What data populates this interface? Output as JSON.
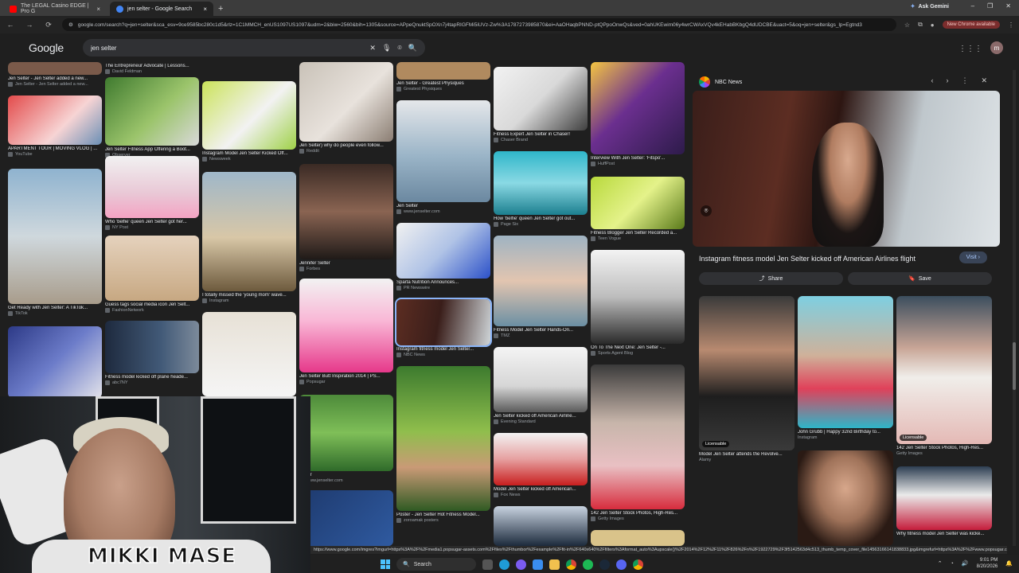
{
  "browser": {
    "tabs": [
      {
        "title": "The LEGAL Casino EDGE | Pro G",
        "color": "#ff0000"
      },
      {
        "title": "jen selter - Google Search",
        "color": "#4285f4"
      }
    ],
    "ask_gemini": "Ask Gemini",
    "url": "google.com/search?q=jen+selter&sca_esv=9ce9585bc280c1d5&rlz=1C1MMCH_enUS1097US1097&udm=2&biw=2560&bih=1305&source=APpeQnuktSpOXn7j4tapRIGFMi5iUVz-Zw%3A1787273985870&ei=AaOHaqbPNND-ptQPpoOnwQs&ved=0ahUKEwim06y4wrCWAxVQv4kEHabBKbgQ4dUDCBE&uact=5&oq=jen+selter&gs_lp=Egtnd3",
    "new_chrome": "New Chrome available"
  },
  "google": {
    "logo": "Google",
    "query": "jen selter"
  },
  "results": [
    {
      "cap": "Jen Selter - Jen Selter added a new...",
      "src": "Jen Selter - Jen Selter added a new..."
    },
    {
      "cap": "APARTMENT TOUR | MOVING VLOG | ...",
      "src": "YouTube"
    },
    {
      "cap": "Get Ready with Jen Selter: A TikTok...",
      "src": "TikTok"
    },
    {
      "cap": "",
      "src": ""
    },
    {
      "cap": "The Entrepreneur Advocate | Lessons...",
      "src": "David Feldman"
    },
    {
      "cap": "Jen Selter Fitness App Offering a Boot...",
      "src": "Observer"
    },
    {
      "cap": "Who 'belfie' queen Jen Selter got her...",
      "src": "NY Post"
    },
    {
      "cap": "Guess tags social media icon Jen Selt...",
      "src": "FashionNetwork"
    },
    {
      "cap": "Fitness model kicked off plane heade...",
      "src": "abc7NY"
    },
    {
      "cap": "Instagram Model Jen Selter Kicked Off...",
      "src": "Newsweek"
    },
    {
      "cap": "I totally missed the 'young mom' wave...",
      "src": "Instagram"
    },
    {
      "cap": "",
      "src": ""
    },
    {
      "cap": "Jen Selter) why do people even follow...",
      "src": "Reddit"
    },
    {
      "cap": "Jennifer Selter",
      "src": "Forbes"
    },
    {
      "cap": "Jen Selter Butt Inspiration 2014 | PS...",
      "src": "Popsugar"
    },
    {
      "cap": "Selter",
      "src": "www.jenselter.com"
    },
    {
      "cap": "Jen Selter - Greatest Physiques",
      "src": "Greatest Physiques"
    },
    {
      "cap": "Jen Selter",
      "src": "www.jenselter.com"
    },
    {
      "cap": "Sparta Nutrition Announces...",
      "src": "PR Newswire"
    },
    {
      "cap": "Instagram fitness model Jen Selter...",
      "src": "NBC News"
    },
    {
      "cap": "Poster - Jen Selter Hot Fitness Model...",
      "src": "zoroamak posters"
    },
    {
      "cap": "Fitness Expert Jen Selter in Chaser!",
      "src": "Chaser Brand"
    },
    {
      "cap": "How 'belfie' queen Jen Selter got out...",
      "src": "Page Six"
    },
    {
      "cap": "Fitness Model Jen Selter Hands-On...",
      "src": "TMZ"
    },
    {
      "cap": "Jen Selter kicked off American Airline...",
      "src": "Evening Standard"
    },
    {
      "cap": "Model Jen Selter kicked off American...",
      "src": "Fox News"
    },
    {
      "cap": "Interview With Jen Selter: 'Fitspo'...",
      "src": "HuffPost"
    },
    {
      "cap": "Fitness Blogger Jen Selter Recorded a...",
      "src": "Teen Vogue"
    },
    {
      "cap": "On To The Next One: Jen Selter -...",
      "src": "Sports Agent Blog"
    },
    {
      "cap": "142 Jen Selter Stock Photos, High-Res...",
      "src": "Getty Images"
    }
  ],
  "panel": {
    "source": "NBC News",
    "title": "Instagram fitness model Jen Selter kicked off American Airlines flight",
    "visit": "Visit",
    "share": "Share",
    "save": "Save",
    "related": [
      {
        "cap": "Model Jen Selter attends the Revolve...",
        "src": "Alamy",
        "lic": "Licensable"
      },
      {
        "cap": "John Grubb | Happy 32nd Birthday to...",
        "src": "Instagram",
        "lic": ""
      },
      {
        "cap": "142 Jen Selter Stock Photos, High-Res...",
        "src": "Getty Images",
        "lic": "Licensable"
      },
      {
        "cap": "",
        "src": "",
        "lic": ""
      },
      {
        "cap": "Why fitness model Jen Selter was kicke...",
        "src": "",
        "lic": ""
      }
    ]
  },
  "overlay": {
    "streamer": "MIKKI MASE",
    "status_url": "https://www.google.com/imgres?imgurl=https%3A%2F%2Fmedia1.popsugar-assets.com%2Ffiles%2Fthumbor%2Fexample%2Ffit-in%2F640x640%2Ffilters%3Aformat_auto%3Aupscale()%2F2014%2F12%2F11%2F826%2Fn%2F1922729%2F3f5142563d4c513_thumb_temp_cover_file14563166141838833.jpg&imgrefurl=https%3A%2F%2Fwww.popsugar.com%2Ffitness%2Fjen-selter-butt-inspiration-2014-36259322&docid=msQUdxWS"
  },
  "taskbar": {
    "search": "Search",
    "time": "9:01 PM",
    "date": "8/20/2026"
  }
}
